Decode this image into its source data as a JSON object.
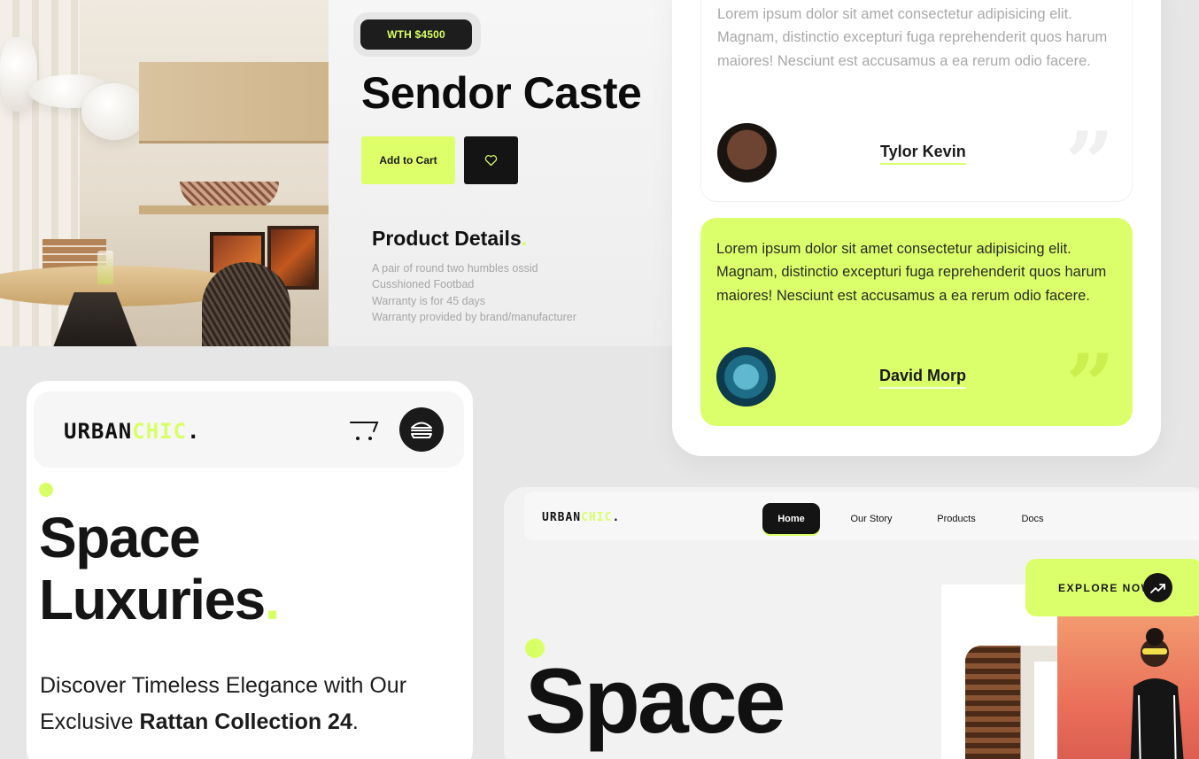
{
  "product": {
    "price_badge": "WTH $4500",
    "title": "Sendor Caste",
    "add_to_cart_label": "Add to Cart",
    "details_title": "Product Details",
    "details": [
      "A pair of round two humbles ossid",
      "Cusshioned Footbad",
      "Warranty is for 45 days",
      "Warranty provided by brand/manufacturer"
    ]
  },
  "testimonials": [
    {
      "text": "Lorem ipsum dolor sit amet consectetur adipisicing elit. Magnam, distinctio excepturi fuga reprehenderit quos harum maiores! Nesciunt est accusamus a ea rerum odio facere.",
      "name": "Tylor Kevin"
    },
    {
      "text": "Lorem ipsum dolor sit amet consectetur adipisicing elit. Magnam, distinctio excepturi fuga reprehenderit quos harum maiores! Nesciunt est accusamus a ea rerum odio facere.",
      "name": "David Morp"
    }
  ],
  "quote_mark": "”",
  "brand": {
    "urban": "URBAN",
    "chic": "CHIC",
    "dot": "."
  },
  "mobile": {
    "heading_line1": "Space",
    "heading_line2": "Luxuries",
    "heading_dot": ".",
    "subtitle_prefix": "Discover Timeless Elegance with Our Exclusive ",
    "subtitle_bold": "Rattan Collection 24",
    "subtitle_suffix": "."
  },
  "desktop": {
    "nav": [
      "Home",
      "Our Story",
      "Products",
      "Docs"
    ],
    "active_nav": "Home",
    "explore_label": "EXPLORE NOW",
    "heading": "Space"
  },
  "colors": {
    "accent": "#d9ff66",
    "dark": "#141414",
    "background": "#e6e6e6"
  }
}
